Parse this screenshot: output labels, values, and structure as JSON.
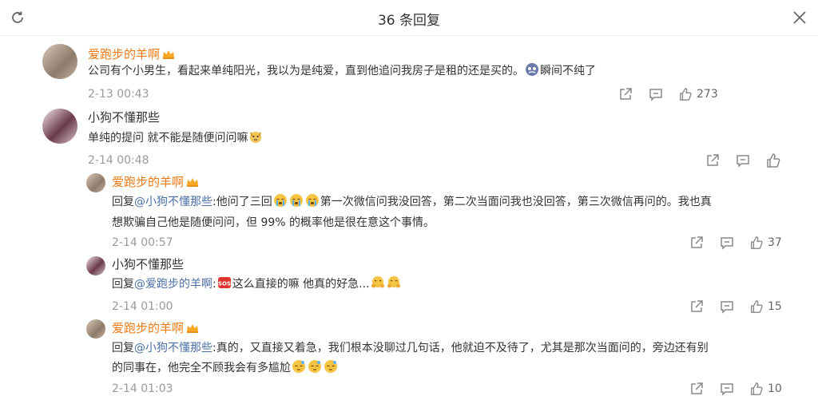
{
  "header": {
    "title": "36 条回复"
  },
  "comments": [
    {
      "user": "爱跑步的羊啊",
      "text_before": "公司有个小男生，看起来单纯阳光，我以为是纯爱，直到他追问我房子是租的还是买的。",
      "text_after": "瞬间不纯了",
      "time": "2-13 00:43",
      "likes": "273"
    },
    {
      "user": "小狗不懂那些",
      "text": "单纯的提问 就不能是随便问问嘛",
      "time": "2-14 00:48"
    },
    {
      "user": "爱跑步的羊啊",
      "reply_prefix": "回复",
      "mention": "@小狗不懂那些",
      "text_a": ":他问了三回",
      "text_b": "第一次微信问我没回答，第二次当面问我也没回答，第三次微信再问的。我也真",
      "line2": "想欺骗自己他是随便问问，但 99% 的概率他是很在意这个事情。",
      "time": "2-14 00:57",
      "likes": "37"
    },
    {
      "user": "小狗不懂那些",
      "reply_prefix": "回复",
      "mention": "@爱跑步的羊啊",
      "colon": ":",
      "text_a": "这么直接的嘛 他真的好急...",
      "time": "2-14 01:00",
      "likes": "15"
    },
    {
      "user": "爱跑步的羊啊",
      "reply_prefix": "回复",
      "mention": "@小狗不懂那些",
      "text_a": ":真的，又直接又着急，我们根本没聊过几句话，他就迫不及待了，尤其是那次当面问的，旁边还有别",
      "line2": "的同事在，他完全不顾我会有多尴尬",
      "time": "2-14 01:03",
      "likes": "10"
    }
  ],
  "icons": {
    "refresh": "refresh-icon",
    "close": "close-icon",
    "share": "share-icon",
    "comment": "comment-icon",
    "like": "thumbs-up-icon",
    "crown": "crown-badge-icon"
  },
  "colors": {
    "username_orange": "#f07b16",
    "mention_blue": "#4a6fa5",
    "time_gray": "#9a9a9a"
  }
}
